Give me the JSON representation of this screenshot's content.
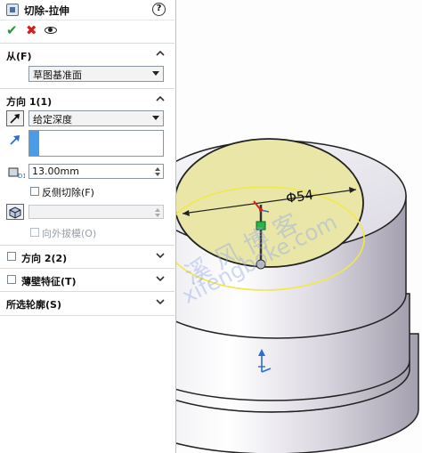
{
  "feature": {
    "title": "切除-拉伸",
    "help_label": "?"
  },
  "icons": {
    "feature": "cut-extrude-icon",
    "help": "help-icon",
    "ok": "checkmark-icon",
    "cancel": "close-icon",
    "preview": "eye-icon",
    "direction": "arrow-icon",
    "depth": "depth-icon",
    "draft": "draft-icon"
  },
  "actions": {
    "ok_glyph": "✔",
    "cancel_glyph": "✖"
  },
  "from_section": {
    "title": "从(F)",
    "start_condition": "草图基准面"
  },
  "direction1": {
    "title": "方向 1(1)",
    "end_condition": "给定深度",
    "depth_value": "13.00mm",
    "flip_side_label": "反侧切除(F)",
    "flip_side_checked": false,
    "draft_outward_label": "向外拔模(O)",
    "draft_outward_checked": false
  },
  "direction2": {
    "title": "方向 2(2)",
    "checked": false
  },
  "thin_feature": {
    "title": "薄壁特征(T)",
    "checked": false
  },
  "selected_contours": {
    "title": "所选轮廓(S)"
  },
  "viewport": {
    "dimension_label": "Φ54",
    "watermark_cn": "溪 风 博 客",
    "watermark_en": "xifengboke.com"
  },
  "colors": {
    "accent": "#2a6ed4",
    "sketch_face": "#e9e6a8",
    "sketch_circle": "#f1e84a",
    "body": "#c8c4cf"
  }
}
